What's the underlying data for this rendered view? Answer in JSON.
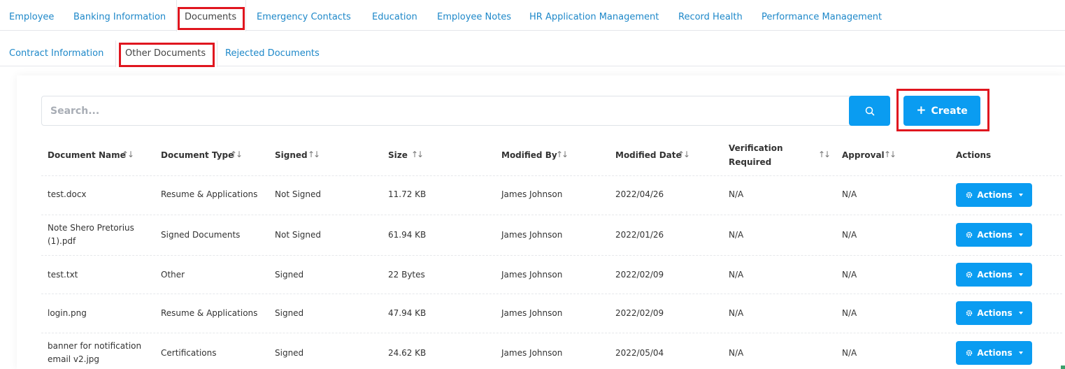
{
  "tabs_primary": [
    {
      "label": "Employee"
    },
    {
      "label": "Banking Information"
    },
    {
      "label": "Documents"
    },
    {
      "label": "Emergency Contacts"
    },
    {
      "label": "Education"
    },
    {
      "label": "Employee Notes"
    },
    {
      "label": "HR Application Management"
    },
    {
      "label": "Record Health"
    },
    {
      "label": "Performance Management"
    }
  ],
  "tabs_secondary": [
    {
      "label": "Contract Information"
    },
    {
      "label": "Other Documents"
    },
    {
      "label": "Rejected Documents"
    }
  ],
  "search": {
    "placeholder": "Search..."
  },
  "create_button": {
    "label": "Create",
    "icon": "plus-icon"
  },
  "table": {
    "headers": [
      {
        "label": "Document Name"
      },
      {
        "label": "Document Type"
      },
      {
        "label": "Signed"
      },
      {
        "label": "Size"
      },
      {
        "label": "Modified By"
      },
      {
        "label": "Modified Date"
      },
      {
        "label": "Verification",
        "label2": "Required"
      },
      {
        "label": "Approval"
      },
      {
        "label": "Actions"
      }
    ],
    "rows": [
      {
        "name": "test.docx",
        "name2": "",
        "type": "Resume & Applications",
        "signed": "Not Signed",
        "size": "11.72 KB",
        "modified_by": "James Johnson",
        "modified_date": "2022/04/26",
        "verification": "N/A",
        "approval": "N/A",
        "action": "Actions"
      },
      {
        "name": "Note Shero Pretorius",
        "name2": "(1).pdf",
        "type": "Signed Documents",
        "signed": "Not Signed",
        "size": "61.94 KB",
        "modified_by": "James Johnson",
        "modified_date": "2022/01/26",
        "verification": "N/A",
        "approval": "N/A",
        "action": "Actions"
      },
      {
        "name": "test.txt",
        "name2": "",
        "type": "Other",
        "signed": "Signed",
        "size": "22 Bytes",
        "modified_by": "James Johnson",
        "modified_date": "2022/02/09",
        "verification": "N/A",
        "approval": "N/A",
        "action": "Actions"
      },
      {
        "name": "login.png",
        "name2": "",
        "type": "Resume & Applications",
        "signed": "Signed",
        "size": "47.94 KB",
        "modified_by": "James Johnson",
        "modified_date": "2022/02/09",
        "verification": "N/A",
        "approval": "N/A",
        "action": "Actions"
      },
      {
        "name": "banner for notification",
        "name2": "email v2.jpg",
        "type": "Certifications",
        "signed": "Signed",
        "size": "24.62 KB",
        "modified_by": "James Johnson",
        "modified_date": "2022/05/04",
        "verification": "N/A",
        "approval": "N/A",
        "action": "Actions"
      }
    ]
  },
  "colors": {
    "accent": "#0a9cf1",
    "link": "#1e88c9",
    "highlight": "#e0161f"
  }
}
